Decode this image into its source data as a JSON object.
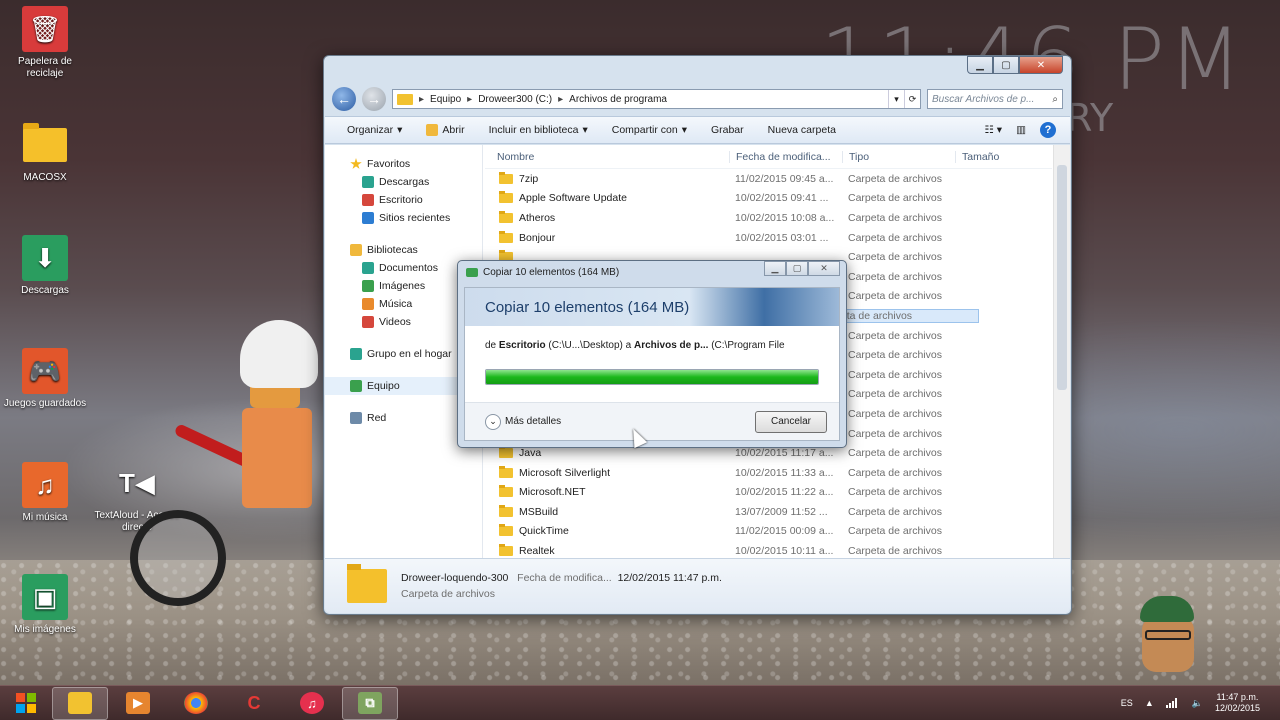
{
  "desktop": {
    "clock_big": "11:46 PM",
    "clock_sub": "ARY",
    "icons": [
      {
        "label": "Papelera de reciclaje"
      },
      {
        "label": "MACOSX"
      },
      {
        "label": "Descargas"
      },
      {
        "label": "Juegos guardados"
      },
      {
        "label": "Mi música"
      },
      {
        "label": "TextAloud - Acceso directo"
      },
      {
        "label": "Mis imágenes"
      }
    ]
  },
  "explorer": {
    "breadcrumb": [
      "Equipo",
      "Droweer300 (C:)",
      "Archivos de programa"
    ],
    "search_placeholder": "Buscar Archivos de p...",
    "toolbar": {
      "organize": "Organizar",
      "open": "Abrir",
      "include_library": "Incluir en biblioteca",
      "share": "Compartir con",
      "burn": "Grabar",
      "new_folder": "Nueva carpeta"
    },
    "nav": {
      "favorites": "Favoritos",
      "favorites_items": [
        "Descargas",
        "Escritorio",
        "Sitios recientes"
      ],
      "libraries": "Bibliotecas",
      "libraries_items": [
        "Documentos",
        "Imágenes",
        "Música",
        "Videos"
      ],
      "homegroup": "Grupo en el hogar",
      "computer": "Equipo",
      "network": "Red"
    },
    "columns": {
      "name": "Nombre",
      "date": "Fecha de modifica...",
      "type": "Tipo",
      "size": "Tamaño"
    },
    "rows": [
      {
        "name": "7zip",
        "date": "11/02/2015 09:45 a...",
        "type": "Carpeta de archivos"
      },
      {
        "name": "Apple Software Update",
        "date": "10/02/2015 09:41 ...",
        "type": "Carpeta de archivos"
      },
      {
        "name": "Atheros",
        "date": "10/02/2015 10:08 a...",
        "type": "Carpeta de archivos"
      },
      {
        "name": "Bonjour",
        "date": "10/02/2015 03:01 ...",
        "type": "Carpeta de archivos"
      },
      {
        "name": "",
        "date": "",
        "type": "Carpeta de archivos"
      },
      {
        "name": "",
        "date": "",
        "type": "Carpeta de archivos"
      },
      {
        "name": "",
        "date": "",
        "type": "Carpeta de archivos"
      },
      {
        "name": "",
        "date": "",
        "type": "Carpeta de archivos"
      },
      {
        "name": "",
        "date": "",
        "type": "Carpeta de archivos"
      },
      {
        "name": "",
        "date": "",
        "type": "Carpeta de archivos"
      },
      {
        "name": "",
        "date": "",
        "type": "Carpeta de archivos"
      },
      {
        "name": "",
        "date": "",
        "type": "Carpeta de archivos"
      },
      {
        "name": "",
        "date": "",
        "type": "Carpeta de archivos"
      },
      {
        "name": "",
        "date": "",
        "type": "Carpeta de archivos"
      },
      {
        "name": "Java",
        "date": "10/02/2015 11:17 a...",
        "type": "Carpeta de archivos"
      },
      {
        "name": "Microsoft Silverlight",
        "date": "10/02/2015 11:33 a...",
        "type": "Carpeta de archivos"
      },
      {
        "name": "Microsoft.NET",
        "date": "10/02/2015 11:22 a...",
        "type": "Carpeta de archivos"
      },
      {
        "name": "MSBuild",
        "date": "13/07/2009 11:52 ...",
        "type": "Carpeta de archivos"
      },
      {
        "name": "QuickTime",
        "date": "11/02/2015 00:09 a...",
        "type": "Carpeta de archivos"
      },
      {
        "name": "Realtek",
        "date": "10/02/2015 10:11 a...",
        "type": "Carpeta de archivos"
      }
    ],
    "details": {
      "name": "Droweer-loquendo-300",
      "date_label": "Fecha de modifica...",
      "date_value": "12/02/2015 11:47 p.m.",
      "type": "Carpeta de archivos"
    }
  },
  "copy_dialog": {
    "title": "Copiar 10 elementos (164 MB)",
    "heading": "Copiar 10 elementos (164 MB)",
    "from_prefix": "de",
    "from_name": "Escritorio",
    "from_path": "(C:\\U...\\Desktop)",
    "to_prefix": "a",
    "to_name": "Archivos de p...",
    "to_path": "(C:\\Program File",
    "progress": 1.0,
    "more_details": "Más detalles",
    "cancel": "Cancelar"
  },
  "taskbar": {
    "language": "ES",
    "time": "11:47 p.m.",
    "date": "12/02/2015"
  }
}
